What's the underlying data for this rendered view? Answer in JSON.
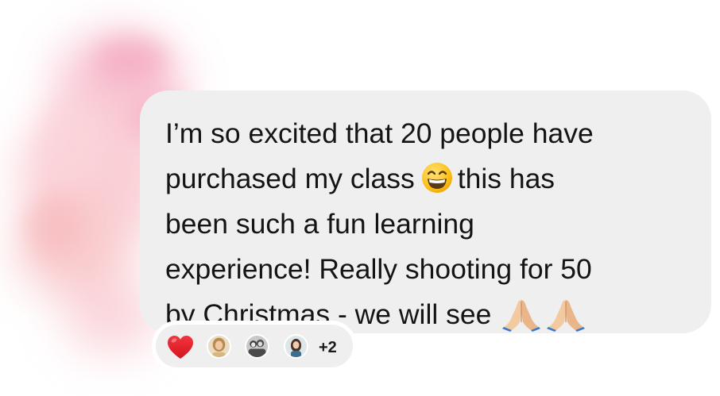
{
  "message": {
    "line1": "I’m so excited that 20 people have",
    "line2_before_emoji": "purchased my class",
    "line2_after_emoji": "this has",
    "line3": "been such a fun learning",
    "line4": "experience! Really shooting for 50",
    "line5": "by Christmas - we will see",
    "emoji_inline": "grinning-squinting-face-icon",
    "emoji_trailing": [
      "folded-hands-icon",
      "folded-hands-icon"
    ]
  },
  "reactions": {
    "emoji": "heart-icon",
    "avatars": [
      "reactor-avatar-1",
      "reactor-avatar-2",
      "reactor-avatar-3"
    ],
    "extra_count": "+2"
  },
  "colors": {
    "bubble": "#efefef",
    "text": "#141414",
    "heart": "#e31b2c",
    "watercolor": "#f6b8c6"
  }
}
